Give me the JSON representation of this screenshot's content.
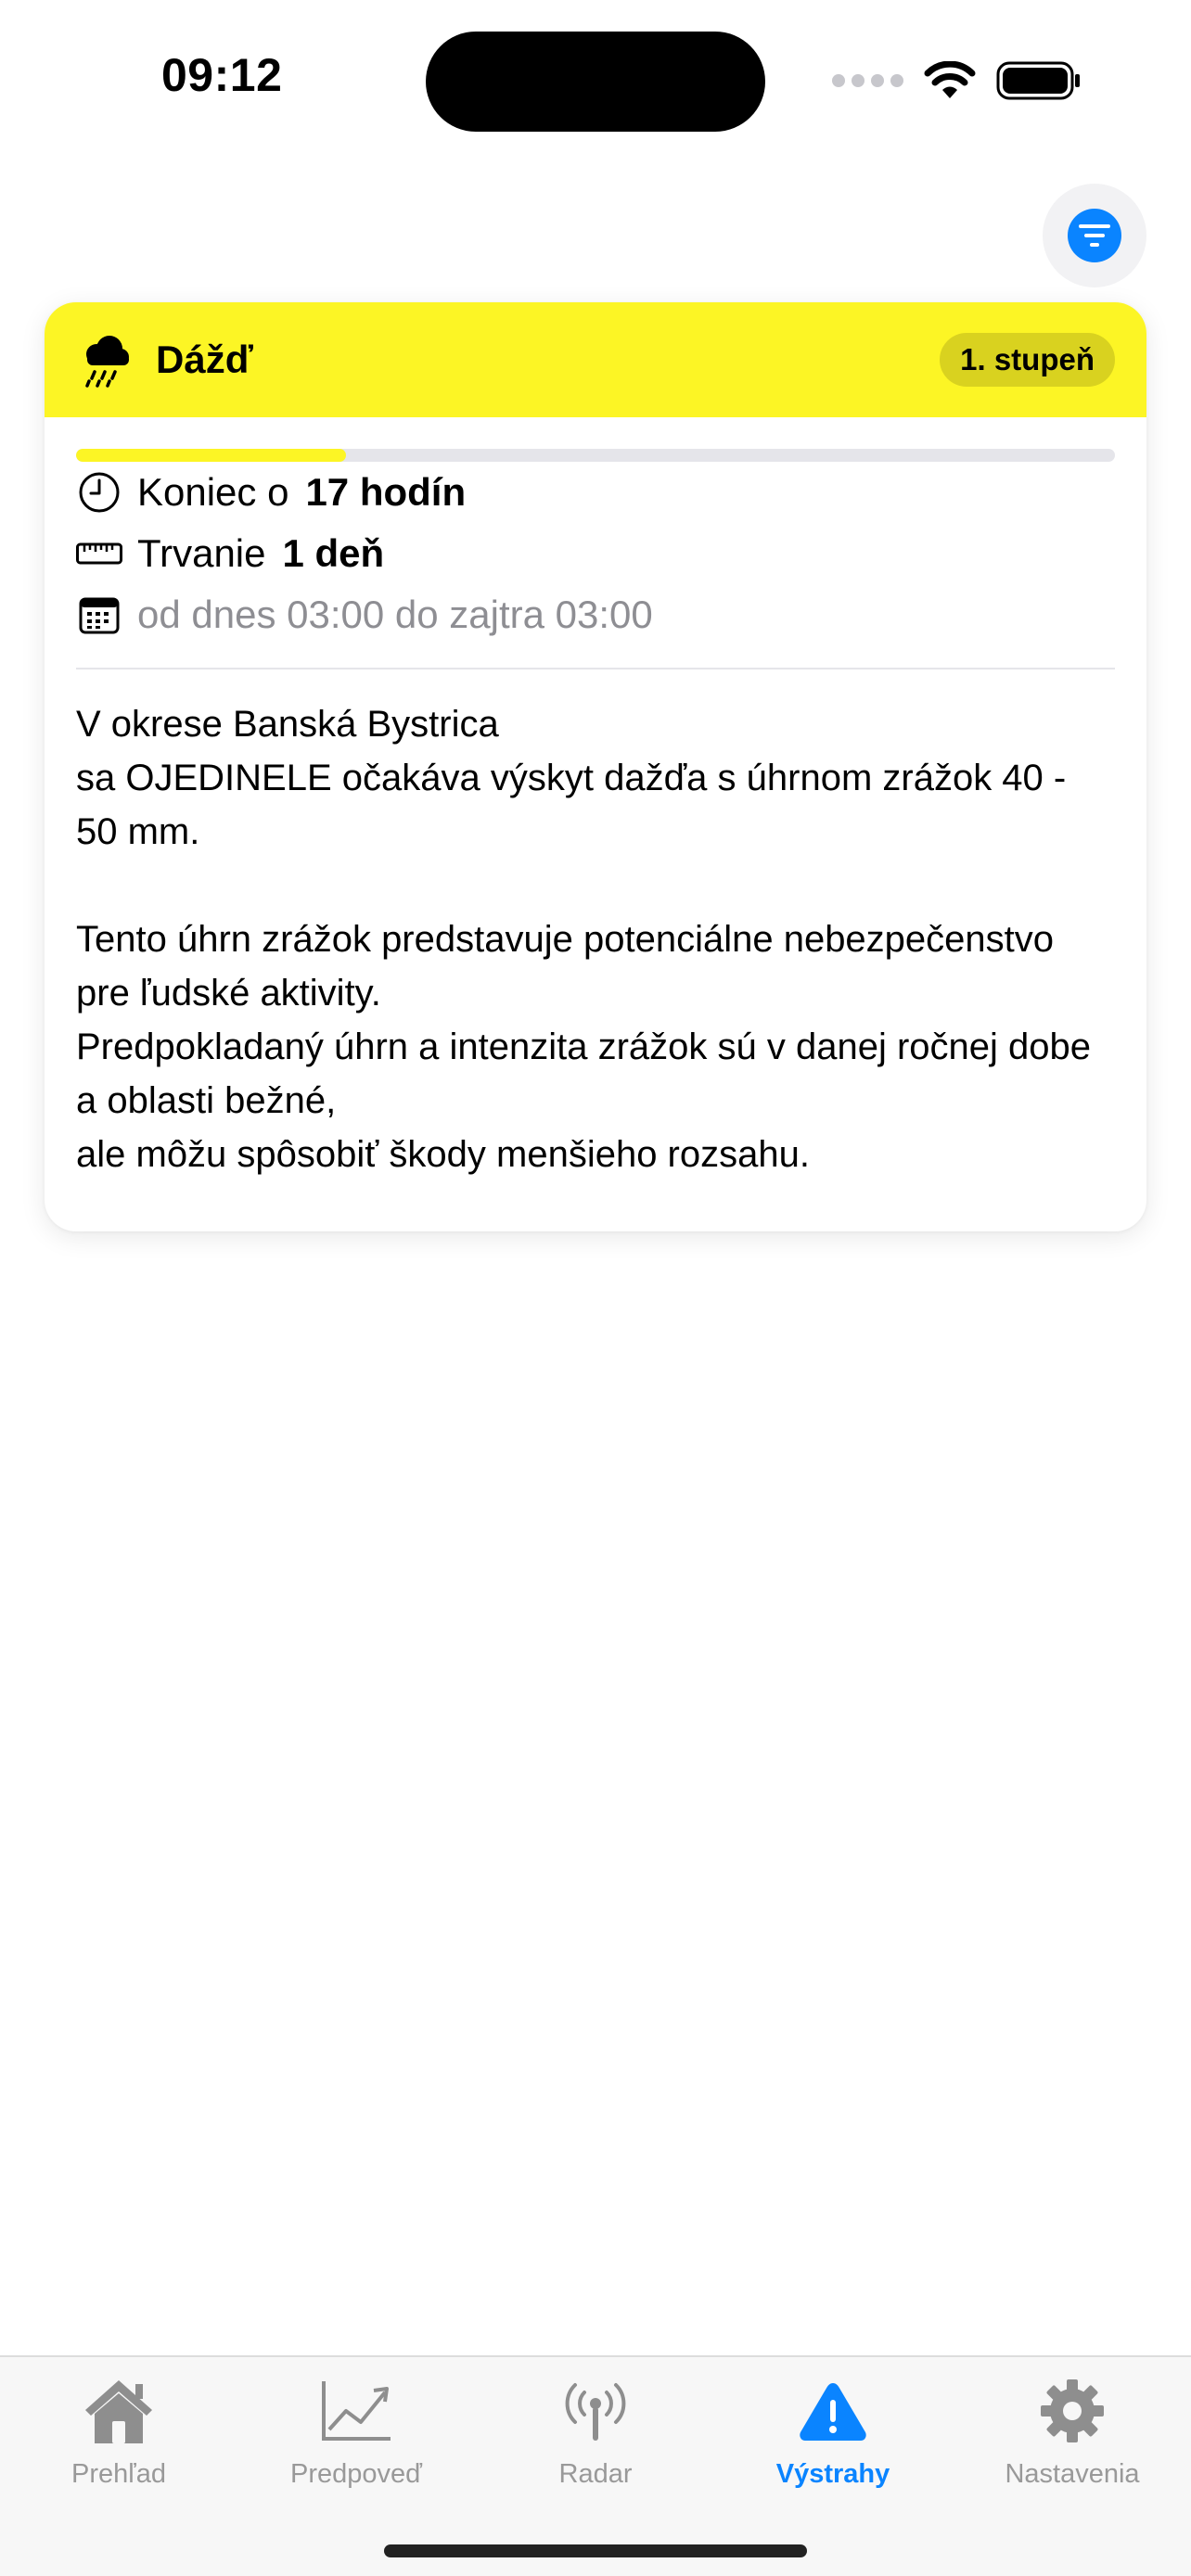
{
  "status_bar": {
    "time": "09:12"
  },
  "filter": {
    "icon": "filter-icon",
    "color": "#0a84ff"
  },
  "warning": {
    "icon": "cloud-rain-icon",
    "title": "Dážď",
    "level": "1. stupeň",
    "header_color": "#fcf525",
    "progress_fraction": 0.26,
    "end": {
      "label": "Koniec o",
      "value": "17 hodín"
    },
    "duration": {
      "label": "Trvanie",
      "value": "1 deň"
    },
    "period": "od dnes 03:00 do zajtra 03:00",
    "description": "V okrese Banská Bystrica\nsa OJEDINELE očakáva výskyt dažďa s úhrnom zrážok 40 - 50 mm.\n\nTento úhrn zrážok predstavuje potenciálne nebezpečenstvo pre ľudské aktivity.\nPredpokladaný úhrn a intenzita zrážok sú v danej ročnej dobe a oblasti bežné,\nale môžu spôsobiť škody menšieho rozsahu."
  },
  "tabs": [
    {
      "label": "Prehľad",
      "icon": "house-icon",
      "active": false
    },
    {
      "label": "Predpoveď",
      "icon": "chart-icon",
      "active": false
    },
    {
      "label": "Radar",
      "icon": "antenna-icon",
      "active": false
    },
    {
      "label": "Výstrahy",
      "icon": "warning-triangle-icon",
      "active": true
    },
    {
      "label": "Nastavenia",
      "icon": "gear-icon",
      "active": false
    }
  ],
  "colors": {
    "accent": "#0a84ff",
    "inactive": "#999999"
  }
}
